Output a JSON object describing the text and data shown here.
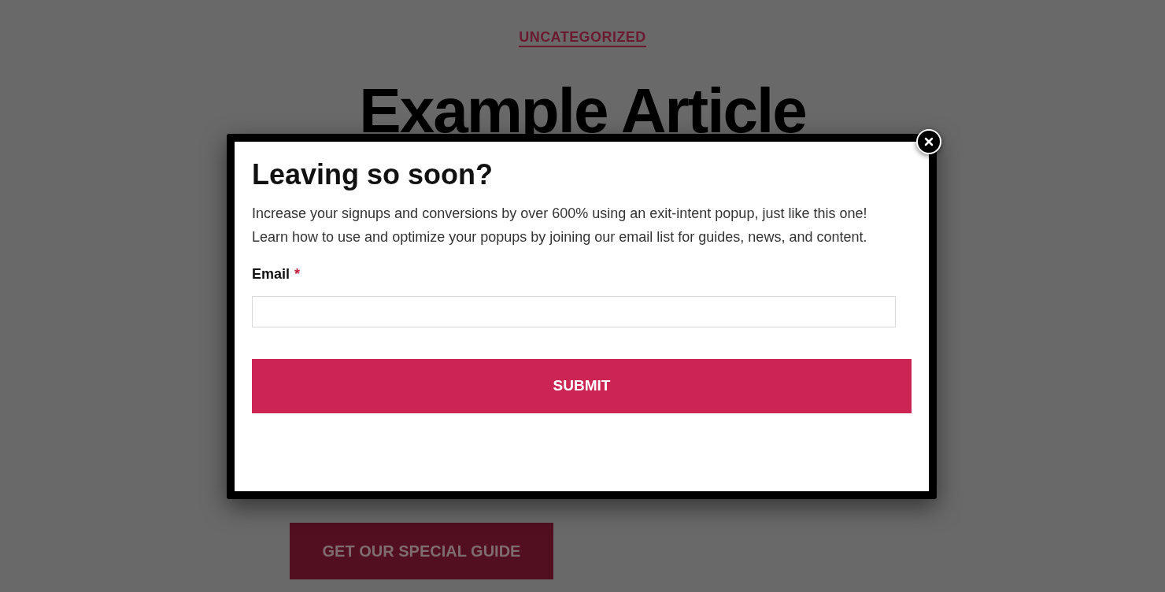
{
  "page": {
    "category": "UNCATEGORIZED",
    "title": "Example Article",
    "cta_button": "GET OUR SPECIAL GUIDE"
  },
  "popup": {
    "heading": "Leaving so soon?",
    "body": "Increase your signups and conversions by over 600% using an exit-intent popup, just like this one! Learn how to use and optimize your popups by joining our email list for guides, news, and content.",
    "email_label": "Email",
    "required_mark": "*",
    "submit": "SUBMIT"
  }
}
